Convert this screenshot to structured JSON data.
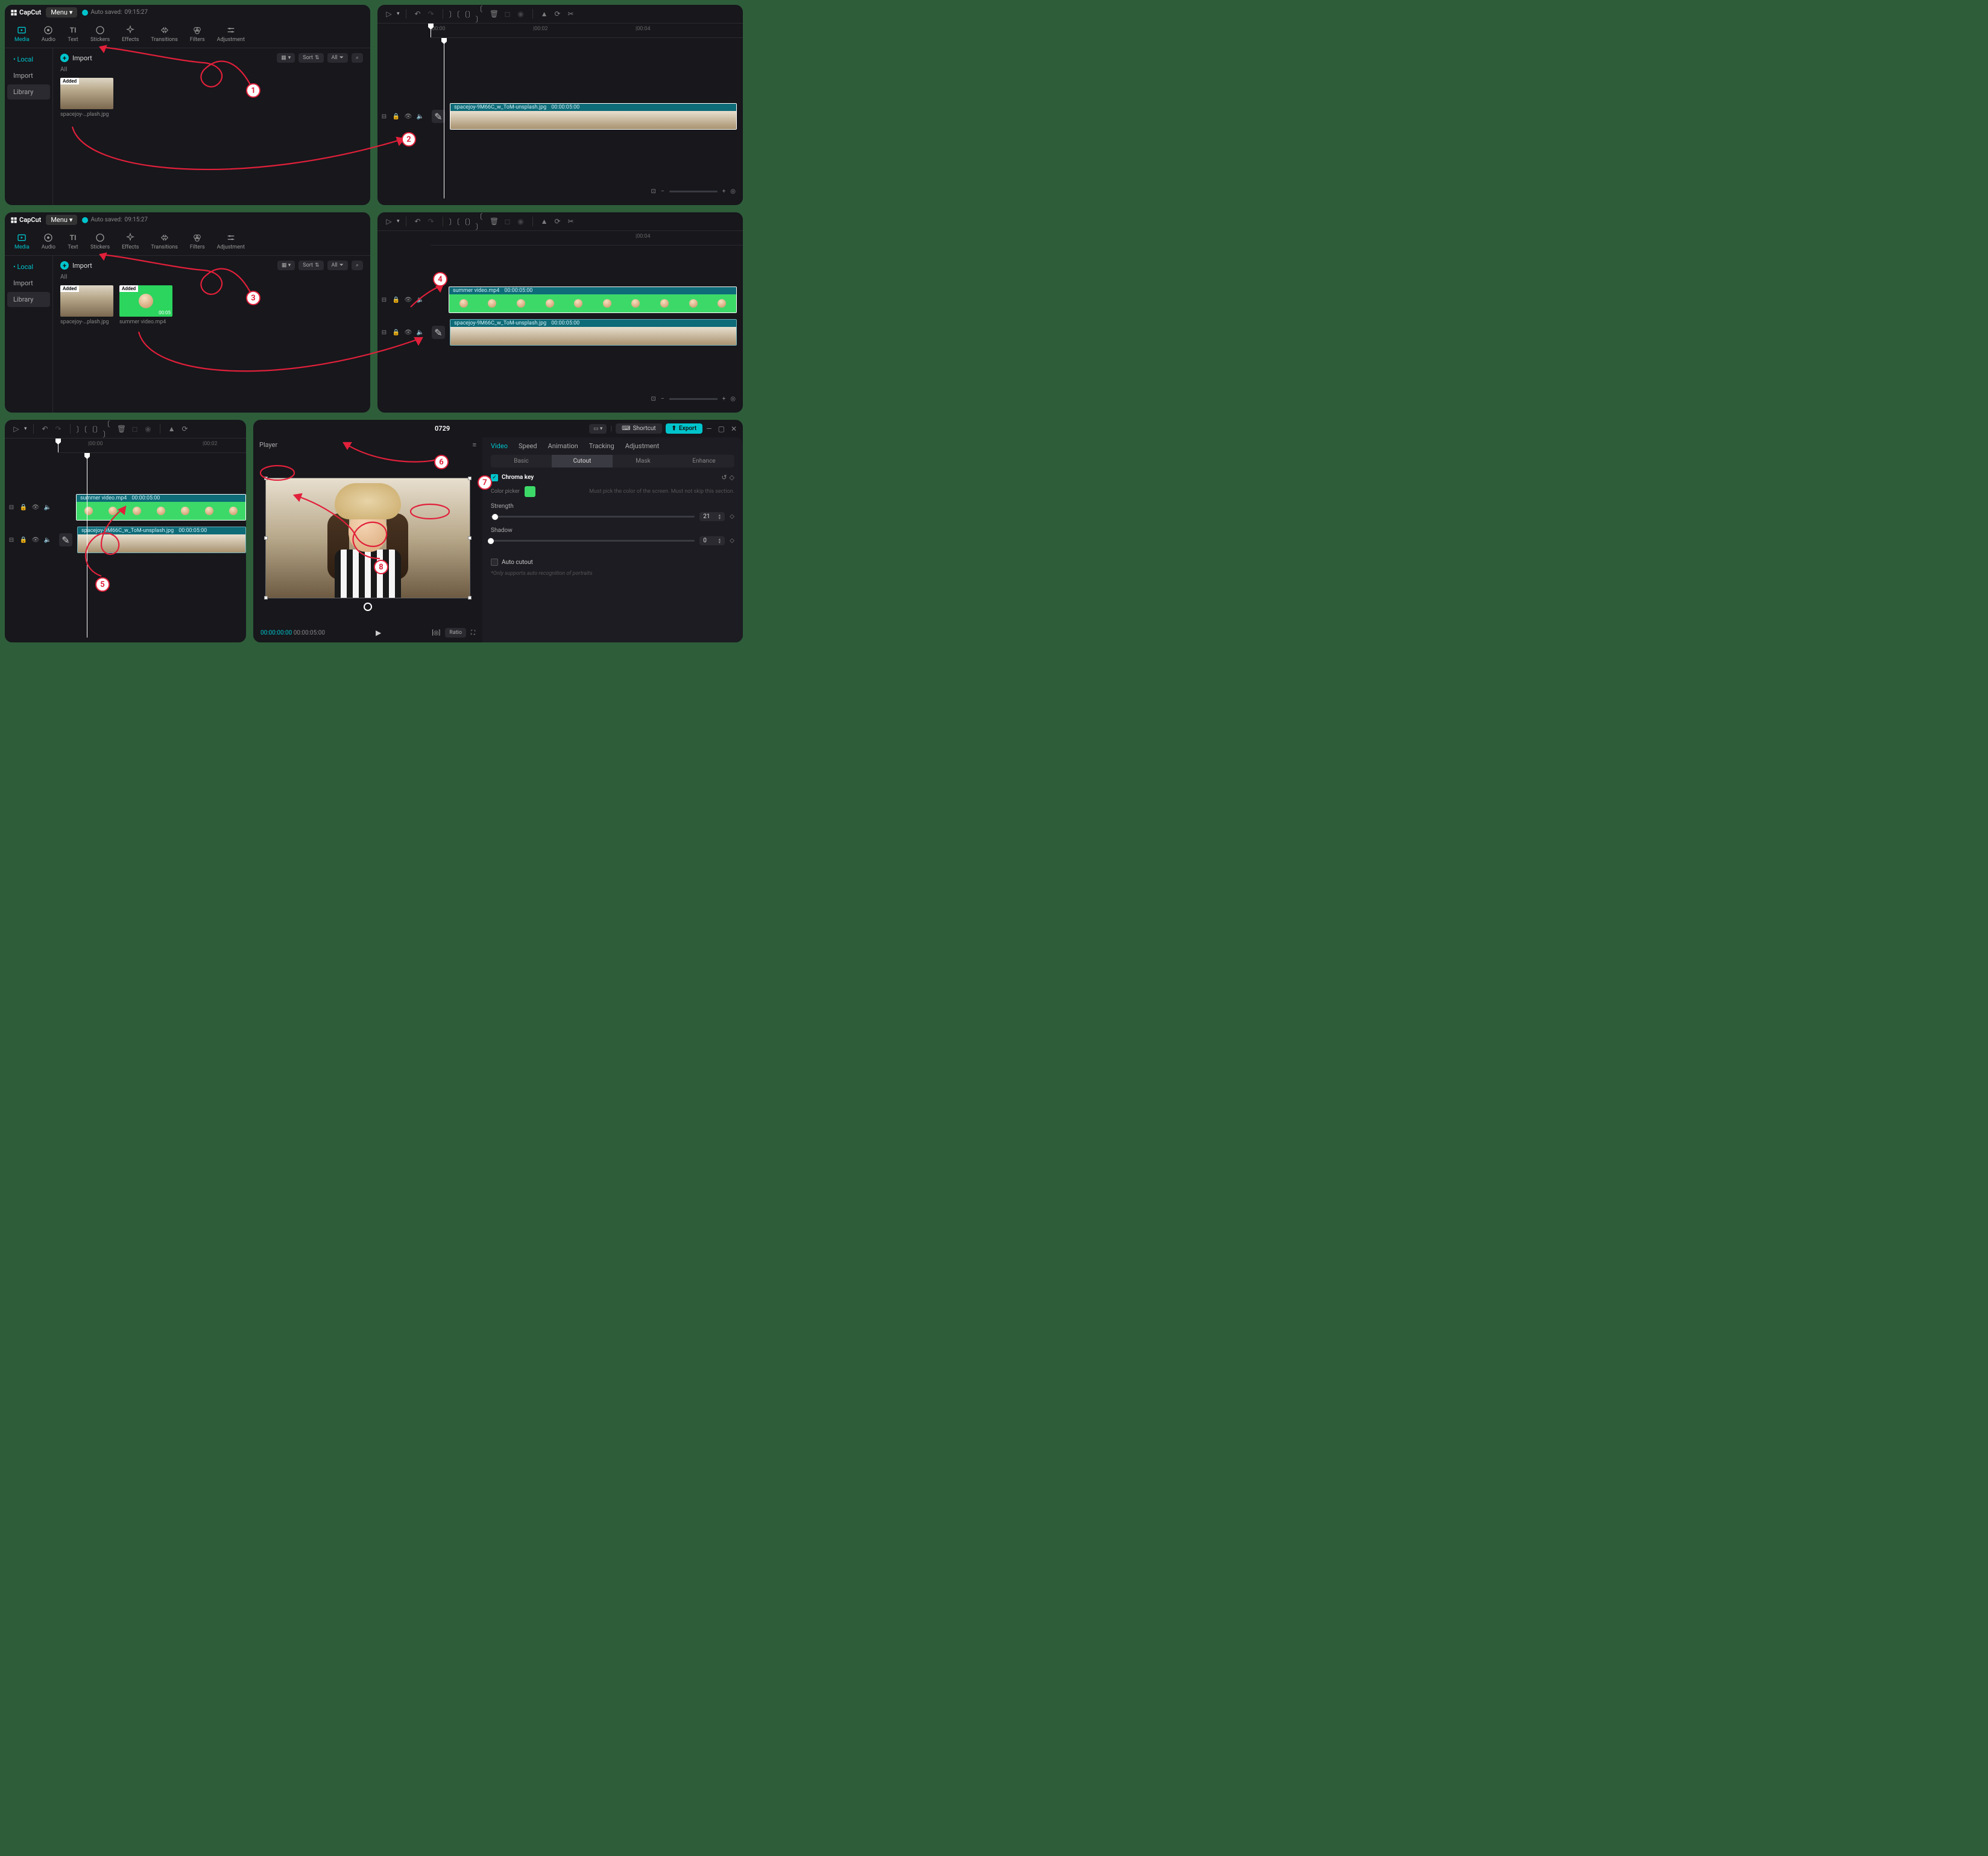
{
  "app": {
    "name": "CapCut",
    "menu": "Menu",
    "autosaved_prefix": "Auto saved:",
    "autosaved_time": "09:15:27"
  },
  "tabs": {
    "media": "Media",
    "audio": "Audio",
    "text": "Text",
    "stickers": "Stickers",
    "effects": "Effects",
    "transitions": "Transitions",
    "filters": "Filters",
    "adjustment": "Adjustment"
  },
  "side": {
    "local": "Local",
    "import": "Import",
    "library": "Library"
  },
  "media": {
    "import": "Import",
    "all": "All",
    "sort": "Sort",
    "all_btn": "All",
    "added": "Added",
    "thumb1_caption": "spacejoy-…plash.jpg",
    "thumb2_caption": "summer video.mp4",
    "thumb2_dur": "00:05"
  },
  "timeline": {
    "t0": "|00:00",
    "t2": "|00:02",
    "t4": "|00:04",
    "clip_image_name": "spacejoy-9M66C_w_ToM-unsplash.jpg",
    "clip_image_dur": "00:00:05:00",
    "clip_video_name": "summer video.mp4",
    "clip_video_dur": "00:00:05:00"
  },
  "header": {
    "project": "0729",
    "shortcut": "Shortcut",
    "export": "Export"
  },
  "player": {
    "title": "Player",
    "time_current": "00:00:00:00",
    "time_total": "00:00:05:00",
    "ratio": "Ratio"
  },
  "props": {
    "tabs": {
      "video": "Video",
      "speed": "Speed",
      "animation": "Animation",
      "tracking": "Tracking",
      "adjustment": "Adjustment"
    },
    "subtabs": {
      "basic": "Basic",
      "cutout": "Cutout",
      "mask": "Mask",
      "enhance": "Enhance"
    },
    "chroma": "Chroma key",
    "picker": "Color picker",
    "picker_hint": "Must pick the color of the screen. Must not skip this section.",
    "strength": "Strength",
    "strength_val": "21",
    "shadow": "Shadow",
    "shadow_val": "0",
    "auto": "Auto cutout",
    "auto_note": "*Only supports auto recognition of portraits"
  },
  "steps": {
    "s1": "1",
    "s2": "2",
    "s3": "3",
    "s4": "4",
    "s5": "5",
    "s6": "6",
    "s7": "7",
    "s8": "8"
  }
}
